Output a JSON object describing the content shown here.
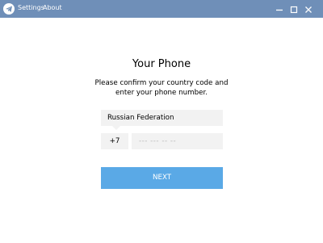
{
  "titlebar": {
    "menu": {
      "settings": "Settings",
      "about": "About"
    },
    "icons": {
      "app": "telegram-icon",
      "minimize": "minimize-icon",
      "maximize": "maximize-icon",
      "close": "close-icon"
    },
    "color": "#6f8fb8"
  },
  "main": {
    "title": "Your Phone",
    "description": "Please confirm your country code and enter your phone number.",
    "country": "Russian Federation",
    "country_code": "+7",
    "phone_placeholder": "--- --- -- --",
    "next_label": "NEXT",
    "accent": "#5aa9e6"
  }
}
